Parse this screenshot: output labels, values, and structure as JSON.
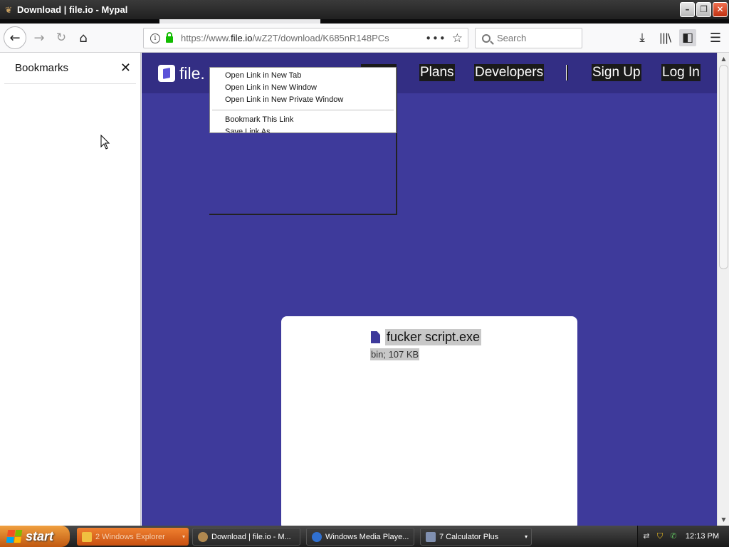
{
  "window": {
    "title": "Download | file.io - Mypal",
    "minimize": "–",
    "restore": "❐",
    "close": "✕"
  },
  "navbar": {
    "back": "←",
    "forward": "→",
    "reload": "↻",
    "home": "⌂",
    "url_prefix": "https://www.",
    "url_domain": "file.io",
    "url_path": "/wZ2T/download/K685nR148PCs",
    "page_actions": "•••",
    "bookmark_star": "☆",
    "search_placeholder": "Search",
    "download": "⤓",
    "library": "|||\\",
    "sidebar": "◧",
    "menu": "☰"
  },
  "sidebar": {
    "title": "Bookmarks",
    "close": "✕"
  },
  "site": {
    "logo_text": "file.",
    "nav": {
      "plans": "Plans",
      "developers": "Developers",
      "signup": "Sign Up",
      "login": "Log In"
    }
  },
  "context_menu": {
    "items": [
      "Open Link in New Tab",
      "Open Link in New Window",
      "Open Link in New Private Window",
      "Bookmark This Link",
      "Save Link As"
    ]
  },
  "file": {
    "name": "fucker script.exe",
    "meta": "bin; 107 KB"
  },
  "scrollbar": {
    "up": "▲",
    "down": "▼"
  },
  "taskbar": {
    "start": "start",
    "tasks": [
      {
        "label": "2 Windows Explorer"
      },
      {
        "label": "Download | file.io - M..."
      },
      {
        "label": "Windows Media Playe..."
      },
      {
        "label": "7 Calculator Plus"
      }
    ],
    "caret": "▾",
    "clock": "12:13 PM"
  },
  "colors": {
    "site_bg": "#3e3a9b",
    "site_header": "#332e84",
    "start_orange": "#e07828"
  }
}
